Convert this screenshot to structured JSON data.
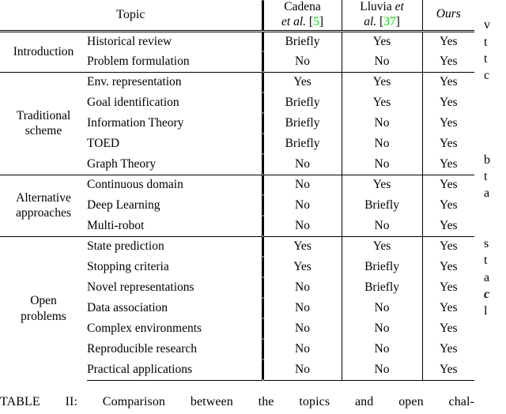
{
  "table": {
    "headers": {
      "topic": "Topic",
      "cadena_line1": "Cadena",
      "cadena_line2_et_al": "et al.",
      "cadena_cite_open": "[",
      "cadena_cite_num": "5",
      "cadena_cite_close": "]",
      "lluvia_line1": "Lluvia",
      "lluvia_line1_et": "et",
      "lluvia_line2_al": "al.",
      "lluvia_cite_open": "[",
      "lluvia_cite_num": "37",
      "lluvia_cite_close": "]",
      "ours": "Ours"
    },
    "cite_color": "#00e000",
    "groups": [
      {
        "label": "Introduction",
        "rows": [
          {
            "topic": "Historical review",
            "cadena": "Briefly",
            "lluvia": "Yes",
            "ours": "Yes"
          },
          {
            "topic": "Problem formulation",
            "cadena": "No",
            "lluvia": "No",
            "ours": "Yes"
          }
        ]
      },
      {
        "label": "Traditional\nscheme",
        "label_line1": "Traditional",
        "label_line2": "scheme",
        "rows": [
          {
            "topic": "Env. representation",
            "cadena": "Yes",
            "lluvia": "Yes",
            "ours": "Yes"
          },
          {
            "topic": "Goal identification",
            "cadena": "Briefly",
            "lluvia": "Yes",
            "ours": "Yes"
          },
          {
            "topic": "Information Theory",
            "cadena": "Briefly",
            "lluvia": "No",
            "ours": "Yes"
          },
          {
            "topic": "TOED",
            "cadena": "Briefly",
            "lluvia": "No",
            "ours": "Yes"
          },
          {
            "topic": "Graph Theory",
            "cadena": "No",
            "lluvia": "No",
            "ours": "Yes"
          }
        ]
      },
      {
        "label": "Alternative\napproaches",
        "label_line1": "Alternative",
        "label_line2": "approaches",
        "rows": [
          {
            "topic": "Continuous domain",
            "cadena": "No",
            "lluvia": "Yes",
            "ours": "Yes"
          },
          {
            "topic": "Deep Learning",
            "cadena": "No",
            "lluvia": "Briefly",
            "ours": "Yes"
          },
          {
            "topic": "Multi-robot",
            "cadena": "No",
            "lluvia": "No",
            "ours": "Yes"
          }
        ]
      },
      {
        "label": "Open\nproblems",
        "label_line1": "Open",
        "label_line2": "problems",
        "rows": [
          {
            "topic": "State prediction",
            "cadena": "Yes",
            "lluvia": "Yes",
            "ours": "Yes"
          },
          {
            "topic": "Stopping criteria",
            "cadena": "Yes",
            "lluvia": "Briefly",
            "ours": "Yes"
          },
          {
            "topic": "Novel representations",
            "cadena": "No",
            "lluvia": "Briefly",
            "ours": "Yes"
          },
          {
            "topic": "Data association",
            "cadena": "No",
            "lluvia": "No",
            "ours": "Yes"
          },
          {
            "topic": "Complex environments",
            "cadena": "No",
            "lluvia": "No",
            "ours": "Yes"
          },
          {
            "topic": "Reproducible research",
            "cadena": "No",
            "lluvia": "No",
            "ours": "Yes"
          },
          {
            "topic": "Practical applications",
            "cadena": "No",
            "lluvia": "No",
            "ours": "Yes"
          }
        ]
      }
    ]
  },
  "caption": {
    "text": "TABLE II: Comparison between the topics and open chal-"
  },
  "margin_column": {
    "lines": [
      "",
      "v",
      "t",
      "t",
      "c",
      "",
      "",
      "",
      "",
      "b",
      "t",
      "a",
      "",
      "",
      "s",
      "t",
      "a",
      "c",
      "l"
    ]
  }
}
